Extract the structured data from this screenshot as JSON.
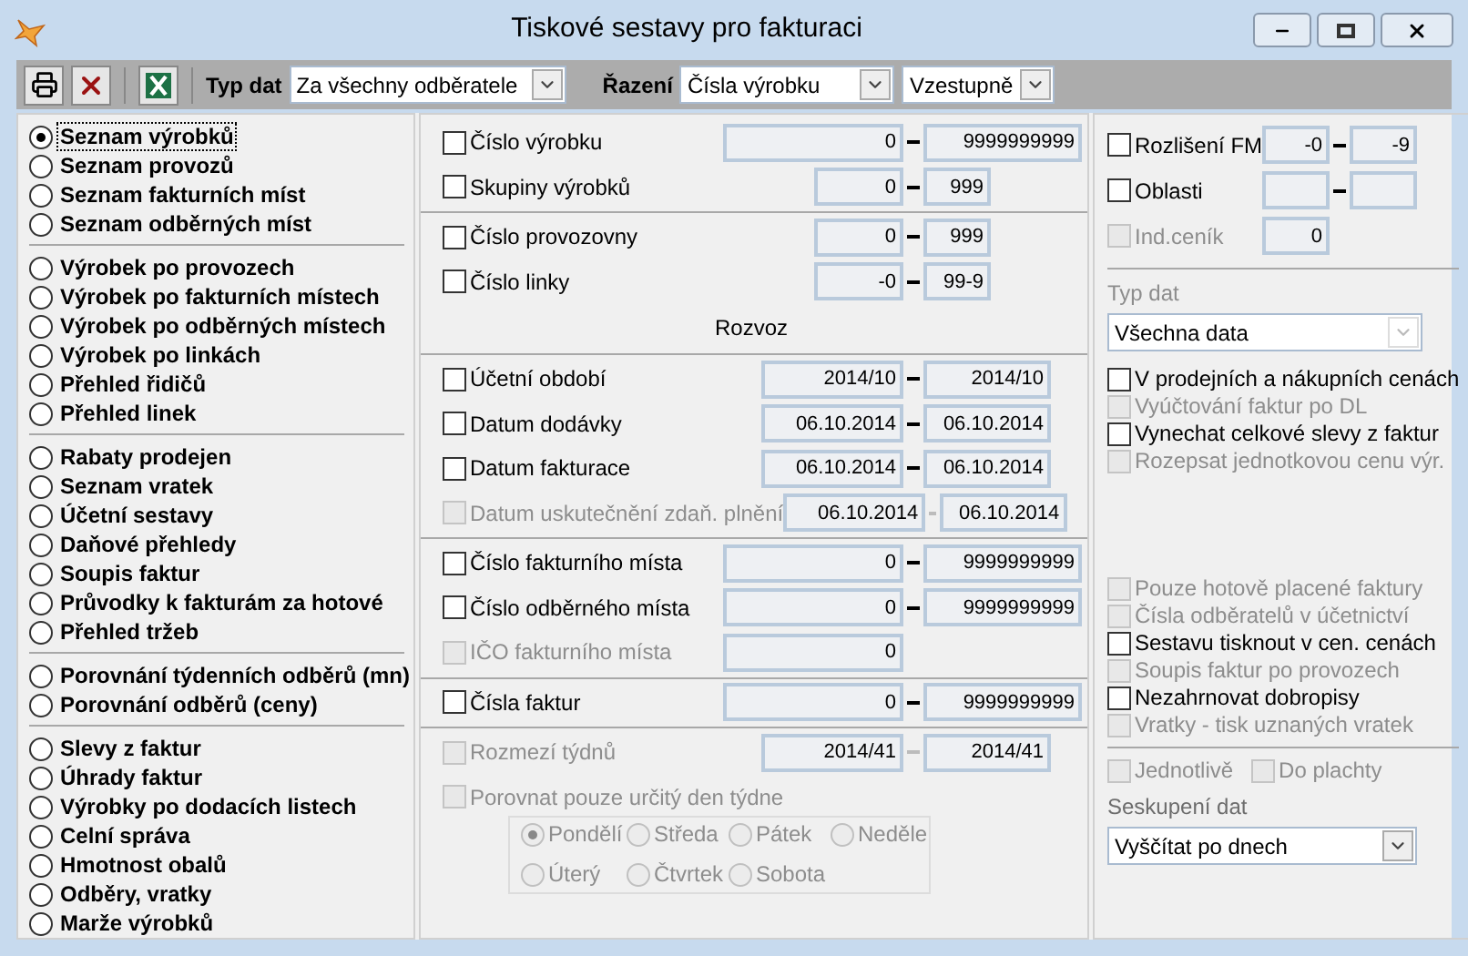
{
  "window": {
    "title": "Tiskové sestavy pro fakturaci"
  },
  "toolbar": {
    "type_label": "Typ dat",
    "type_value": "Za všechny odběratele",
    "sort_label": "Řazení",
    "sort_value": "Čísla výrobku",
    "order_value": "Vzestupně"
  },
  "reports": {
    "groups": [
      [
        {
          "label": "Seznam výrobků",
          "selected": true
        },
        {
          "label": "Seznam provozů",
          "selected": false
        },
        {
          "label": "Seznam fakturních míst",
          "selected": false
        },
        {
          "label": "Seznam odběrných míst",
          "selected": false
        }
      ],
      [
        {
          "label": "Výrobek po provozech",
          "selected": false
        },
        {
          "label": "Výrobek po fakturních místech",
          "selected": false
        },
        {
          "label": "Výrobek po odběrných místech",
          "selected": false
        },
        {
          "label": "Výrobek po linkách",
          "selected": false
        },
        {
          "label": "Přehled řidičů",
          "selected": false
        },
        {
          "label": "Přehled linek",
          "selected": false
        }
      ],
      [
        {
          "label": "Rabaty prodejen",
          "selected": false
        },
        {
          "label": "Seznam vratek",
          "selected": false
        },
        {
          "label": "Účetní sestavy",
          "selected": false
        },
        {
          "label": "Daňové přehledy",
          "selected": false
        },
        {
          "label": "Soupis faktur",
          "selected": false
        },
        {
          "label": "Průvodky k fakturám za hotové",
          "selected": false
        },
        {
          "label": "Přehled tržeb",
          "selected": false
        }
      ],
      [
        {
          "label": "Porovnání týdenních odběrů (mn)",
          "selected": false
        },
        {
          "label": "Porovnání odběrů (ceny)",
          "selected": false
        }
      ],
      [
        {
          "label": "Slevy z faktur",
          "selected": false
        },
        {
          "label": "Úhrady faktur",
          "selected": false
        },
        {
          "label": "Výrobky po dodacích listech",
          "selected": false
        },
        {
          "label": "Celní správa",
          "selected": false
        },
        {
          "label": "Hmotnost obalů",
          "selected": false
        },
        {
          "label": "Odběry, vratky",
          "selected": false
        },
        {
          "label": "Marže výrobků",
          "selected": false
        }
      ]
    ]
  },
  "filters": {
    "sections": [
      {
        "rows": [
          {
            "kind": "wide",
            "label": "Číslo výrobku",
            "checked": false,
            "disabled": false,
            "from": "0",
            "to": "9999999999"
          },
          {
            "kind": "narrow",
            "label": "Skupiny výrobků",
            "checked": false,
            "disabled": false,
            "from": "0",
            "to": "999"
          }
        ]
      },
      {
        "rows": [
          {
            "kind": "narrow",
            "label": "Číslo provozovny",
            "checked": false,
            "disabled": false,
            "from": "0",
            "to": "999"
          },
          {
            "kind": "narrow",
            "label": "Číslo linky",
            "checked": false,
            "disabled": false,
            "from": "-0",
            "to": "99-9"
          },
          {
            "kind": "heading",
            "label": "Rozvoz"
          }
        ]
      },
      {
        "rows": [
          {
            "kind": "date",
            "label": "Účetní období",
            "checked": false,
            "disabled": false,
            "from": "2014/10",
            "to": "2014/10"
          },
          {
            "kind": "date",
            "label": "Datum dodávky",
            "checked": false,
            "disabled": false,
            "from": "06.10.2014",
            "to": "06.10.2014"
          },
          {
            "kind": "date",
            "label": "Datum fakturace",
            "checked": false,
            "disabled": false,
            "from": "06.10.2014",
            "to": "06.10.2014"
          },
          {
            "kind": "date",
            "label": "Datum uskutečnění zdaň. plnění",
            "checked": false,
            "disabled": true,
            "from": "06.10.2014",
            "to": "06.10.2014"
          }
        ]
      },
      {
        "rows": [
          {
            "kind": "wide",
            "label": "Číslo fakturního místa",
            "checked": false,
            "disabled": false,
            "from": "0",
            "to": "9999999999"
          },
          {
            "kind": "wide",
            "label": "Číslo odběrného místa",
            "checked": false,
            "disabled": false,
            "from": "0",
            "to": "9999999999"
          },
          {
            "kind": "single",
            "label": "IČO fakturního místa",
            "checked": false,
            "disabled": true,
            "from": "0"
          }
        ]
      },
      {
        "rows": [
          {
            "kind": "wide",
            "label": "Čísla faktur",
            "checked": false,
            "disabled": false,
            "from": "0",
            "to": "9999999999"
          }
        ]
      },
      {
        "rows": [
          {
            "kind": "date",
            "label": "Rozmezí týdnů",
            "checked": false,
            "disabled": true,
            "from": "2014/41",
            "to": "2014/41"
          },
          {
            "kind": "days",
            "label": "Porovnat pouze určitý den týdne",
            "checked": false,
            "disabled": true,
            "options": [
              {
                "label": "Pondělí",
                "selected": true
              },
              {
                "label": "Středa",
                "selected": false
              },
              {
                "label": "Pátek",
                "selected": false
              },
              {
                "label": "Neděle",
                "selected": false
              },
              {
                "label": "Úterý",
                "selected": false
              },
              {
                "label": "Čtvrtek",
                "selected": false
              },
              {
                "label": "Sobota",
                "selected": false
              }
            ]
          }
        ]
      }
    ]
  },
  "right": {
    "ranges": [
      {
        "kind": "range",
        "label": "Rozlišení FM",
        "checked": false,
        "disabled": false,
        "from": "-0",
        "to": "-9"
      },
      {
        "kind": "range",
        "label": "Oblasti",
        "checked": false,
        "disabled": false
      },
      {
        "kind": "single",
        "label": "Ind.ceník",
        "checked": false,
        "disabled": true,
        "from": "0"
      }
    ],
    "data_type": {
      "label": "Typ dat",
      "value": "Všechna data",
      "disabled": true
    },
    "options": [
      {
        "label": "V prodejních a nákupních cenách",
        "checked": false,
        "disabled": false
      },
      {
        "label": "Vyúčtování faktur po DL",
        "checked": false,
        "disabled": true
      },
      {
        "label": "Vynechat celkové slevy z faktur",
        "checked": false,
        "disabled": false
      },
      {
        "label": "Rozepsat jednotkovou cenu výr.",
        "checked": false,
        "disabled": true
      }
    ],
    "print_options": [
      {
        "label": "Pouze hotově placené faktury",
        "checked": false,
        "disabled": true
      },
      {
        "label": "Čísla odběratelů v účetnictví",
        "checked": false,
        "disabled": true
      },
      {
        "label": "Sestavu tisknout v cen. cenách",
        "checked": false,
        "disabled": false
      },
      {
        "label": "Soupis faktur po provozech",
        "checked": false,
        "disabled": true
      },
      {
        "label": "Nezahrnovat dobropisy",
        "checked": false,
        "disabled": false
      },
      {
        "label": "Vratky - tisk uznaných vratek",
        "checked": false,
        "disabled": true
      }
    ],
    "layout_options": [
      {
        "label": "Jednotlivě",
        "checked": false,
        "disabled": true
      },
      {
        "label": "Do plachty",
        "checked": false,
        "disabled": true
      }
    ],
    "grouping": {
      "label": "Seskupení dat",
      "value": "Vyščítat po dnech"
    }
  }
}
